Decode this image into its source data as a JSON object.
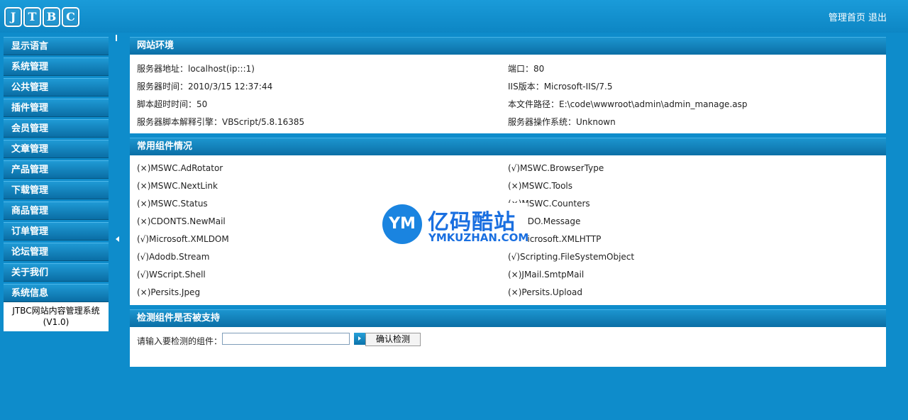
{
  "header": {
    "logo_letters": [
      "J",
      "T",
      "B",
      "C"
    ],
    "home_link": "管理首页",
    "logout_link": "退出"
  },
  "sidebar": {
    "items": [
      {
        "label": "显示语言"
      },
      {
        "label": "系统管理"
      },
      {
        "label": "公共管理"
      },
      {
        "label": "插件管理"
      },
      {
        "label": "会员管理"
      },
      {
        "label": "文章管理"
      },
      {
        "label": "产品管理"
      },
      {
        "label": "下载管理"
      },
      {
        "label": "商品管理"
      },
      {
        "label": "订单管理"
      },
      {
        "label": "论坛管理"
      },
      {
        "label": "关于我们"
      },
      {
        "label": "系统信息"
      }
    ],
    "system_name": "JTBC网站内容管理系统",
    "system_version": "(V1.0)"
  },
  "env_panel": {
    "title": "网站环境",
    "left": [
      "服务器地址：localhost(ip:::1)",
      "服务器时间：2010/3/15 12:37:44",
      "脚本超时时间：50",
      "服务器脚本解释引擎：VBScript/5.8.16385"
    ],
    "right": [
      "端口：80",
      "IIS版本：Microsoft-IIS/7.5",
      "本文件路径：E:\\code\\wwwroot\\admin\\admin_manage.asp",
      "服务器操作系统：Unknown"
    ]
  },
  "components_panel": {
    "title": "常用组件情况",
    "left": [
      "(×)MSWC.AdRotator",
      "(×)MSWC.NextLink",
      "(×)MSWC.Status",
      "(×)CDONTS.NewMail",
      "(√)Microsoft.XMLDOM",
      "(√)Adodb.Stream",
      "(√)WScript.Shell",
      "(×)Persits.Jpeg"
    ],
    "right": [
      "(√)MSWC.BrowserType",
      "(×)MSWC.Tools",
      "(×)MSWC.Counters",
      "(×)CDO.Message",
      "(√)Microsoft.XMLHTTP",
      "(√)Scripting.FileSystemObject",
      "(×)JMail.SmtpMail",
      "(×)Persits.Upload"
    ]
  },
  "check_panel": {
    "title": "检测组件是否被支持",
    "prompt": "请输入要检测的组件：",
    "input_value": "",
    "button_label": "确认检测"
  },
  "watermark": {
    "logo_text": "YM",
    "cn_text": "亿码酷站",
    "en_text": "YMKUZHAN.COM"
  }
}
